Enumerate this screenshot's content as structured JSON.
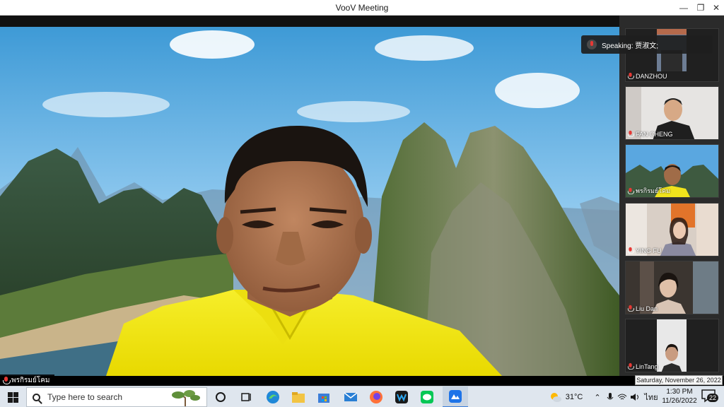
{
  "window": {
    "title": "VooV Meeting",
    "controls": {
      "minimize": "—",
      "maximize": "❐",
      "close": "✕"
    }
  },
  "main_video": {
    "participant_name": "พรกิรมย์โคม",
    "mic_icon": "mic-icon",
    "background": "karst-mountains-river"
  },
  "speaking_indicator": {
    "label": "Speaking: 贾淑文;"
  },
  "participants": [
    {
      "name": "DANZHOU",
      "mic_icon": "mic-icon"
    },
    {
      "name": "FAN CHENG",
      "mic_icon": "mic-icon"
    },
    {
      "name": "พรกิรมย์โคม",
      "mic_icon": "mic-icon"
    },
    {
      "name": "YING FU",
      "mic_icon": "mic-icon"
    },
    {
      "name": "Liu Dan",
      "mic_icon": "mic-icon"
    },
    {
      "name": "LinTang",
      "mic_icon": "mic-icon"
    }
  ],
  "taskbar": {
    "search_placeholder": "Type here to search",
    "pinned_apps": [
      "cortana-icon",
      "task-view-icon",
      "edge-icon",
      "file-explorer-icon",
      "store-icon",
      "mail-icon",
      "firefox-icon",
      "webex-icon",
      "line-icon",
      "voov-icon"
    ],
    "weather": "31°C",
    "language": "ไทย",
    "time": "1:30 PM",
    "date": "11/26/2022",
    "notification_count": "22",
    "date_tooltip": "Saturday, November 26, 2022"
  },
  "colors": {
    "shirt": "#f2e600",
    "accent_blue": "#3b7dd8",
    "mic_red": "#e53935"
  }
}
